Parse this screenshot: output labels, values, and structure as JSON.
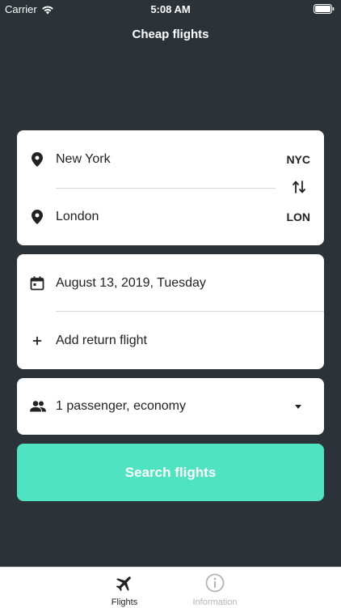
{
  "status_bar": {
    "carrier": "Carrier",
    "time": "5:08 AM"
  },
  "header": {
    "title": "Cheap flights"
  },
  "route": {
    "origin": {
      "city": "New York",
      "code": "NYC"
    },
    "destination": {
      "city": "London",
      "code": "LON"
    }
  },
  "dates": {
    "departure": "August 13, 2019, Tuesday",
    "return_label": "Add return flight"
  },
  "passengers": {
    "label": "1 passenger, economy"
  },
  "search_button": {
    "label": "Search flights"
  },
  "tab_bar": {
    "tabs": [
      {
        "label": "Flights",
        "active": true
      },
      {
        "label": "Information",
        "active": false
      }
    ]
  },
  "colors": {
    "background": "#2b3338",
    "accent": "#4fe3c1",
    "text": "#222222",
    "inactive_tab": "#b5b5b5"
  }
}
